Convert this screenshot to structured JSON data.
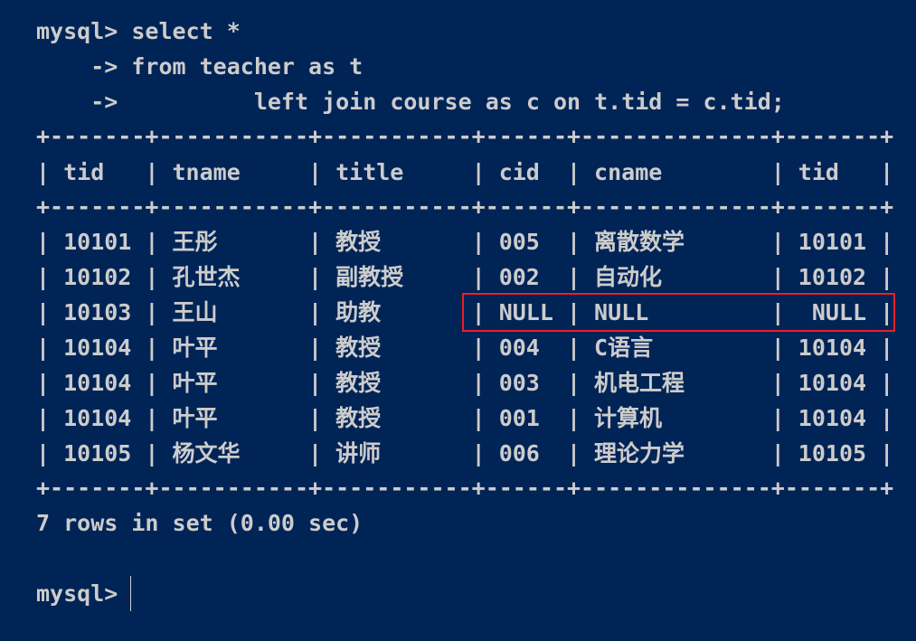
{
  "terminal": {
    "prompt": "mysql>",
    "query_lines": [
      "mysql> select *",
      "    -> from teacher as t",
      "    ->          left join course as c on t.tid = c.tid;"
    ],
    "separator": "+-------+-----------+-----------+------+--------------+-------+",
    "pipe": "|",
    "columns": [
      "tid",
      "tname",
      "title",
      "cid",
      "cname",
      "tid"
    ],
    "rows": [
      [
        "10101",
        "王彤",
        "教授",
        "005",
        "离散数学",
        "10101"
      ],
      [
        "10102",
        "孔世杰",
        "副教授",
        "002",
        "自动化",
        "10102"
      ],
      [
        "10103",
        "王山",
        "助教",
        "NULL",
        "NULL",
        "NULL"
      ],
      [
        "10104",
        "叶平",
        "教授",
        "004",
        "C语言",
        "10104"
      ],
      [
        "10104",
        "叶平",
        "教授",
        "003",
        "机电工程",
        "10104"
      ],
      [
        "10104",
        "叶平",
        "教授",
        "001",
        "计算机",
        "10104"
      ],
      [
        "10105",
        "杨文华",
        "讲师",
        "006",
        "理论力学",
        "10105"
      ]
    ],
    "highlighted_row": 2,
    "highlight_color": "#e8202a",
    "background_color": "#012456",
    "result_summary": "7 rows in set (0.00 sec)",
    "final_prompt": "mysql>"
  }
}
